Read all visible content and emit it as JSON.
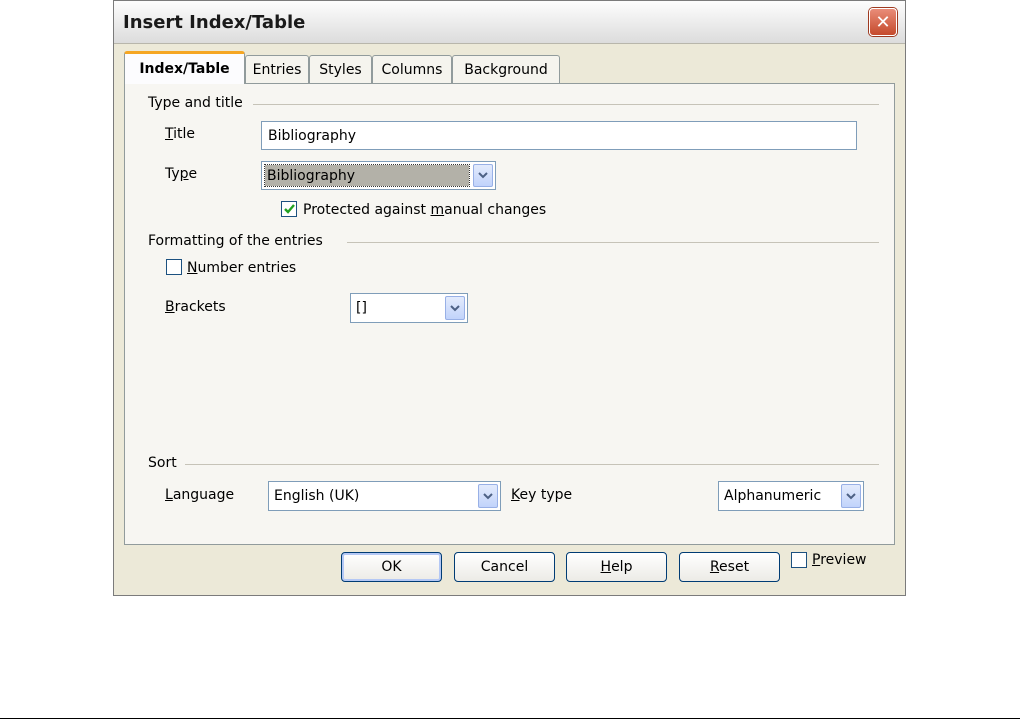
{
  "window": {
    "title": "Insert Index/Table"
  },
  "tabs": [
    {
      "label": "Index/Table",
      "active": true
    },
    {
      "label": "Entries",
      "active": false
    },
    {
      "label": "Styles",
      "active": false
    },
    {
      "label": "Columns",
      "active": false
    },
    {
      "label": "Background",
      "active": false
    }
  ],
  "type_and_title": {
    "heading": "Type and title",
    "title_label": "Title",
    "title_value": "Bibliography",
    "type_label": "Type",
    "type_value": "Bibliography",
    "protected_label_pre": "Protected against ",
    "protected_label_mnemonic": "m",
    "protected_label_post": "anual changes",
    "protected_checked": true
  },
  "formatting": {
    "heading": "Formatting of the entries",
    "number_entries_label": "Number entries",
    "number_entries_checked": false,
    "brackets_label": "Brackets",
    "brackets_value": "[]"
  },
  "sort": {
    "heading": "Sort",
    "language_label": "Language",
    "language_value": "English (UK)",
    "keytype_label": "Key type",
    "keytype_value": "Alphanumeric"
  },
  "buttons": {
    "ok": "OK",
    "cancel": "Cancel",
    "help": "Help",
    "reset": "Reset",
    "preview": "Preview",
    "preview_checked": false
  },
  "colors": {
    "dialog_bg": "#ece9d8",
    "tab_accent": "#f5a623",
    "close_red": "#c54a2c",
    "check_green": "#21a121"
  }
}
